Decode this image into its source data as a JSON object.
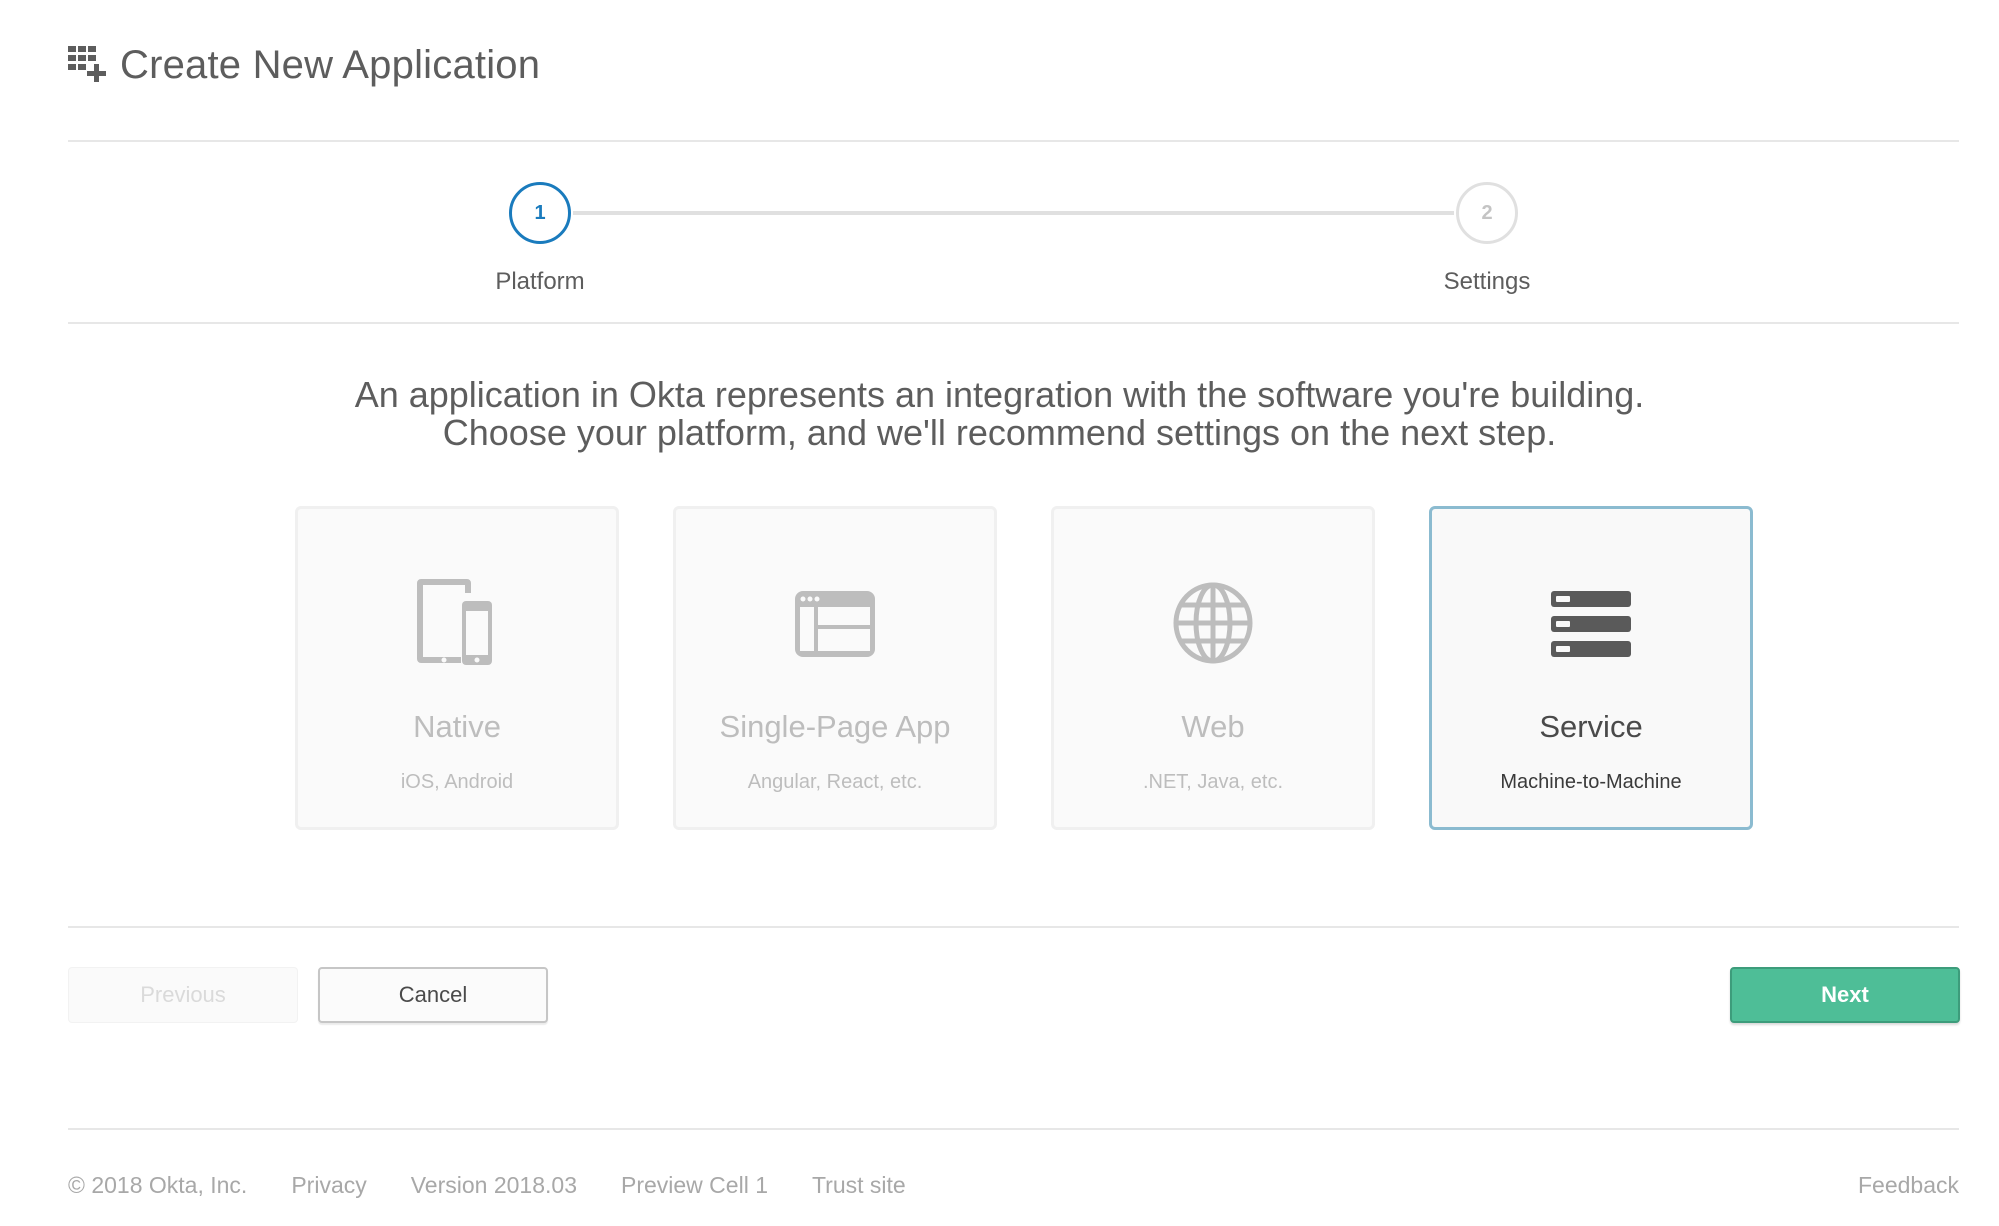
{
  "header": {
    "title": "Create New Application",
    "icon": "grid-add-icon"
  },
  "wizard": {
    "steps": [
      {
        "number": "1",
        "label": "Platform",
        "state": "active"
      },
      {
        "number": "2",
        "label": "Settings",
        "state": "inactive"
      }
    ],
    "accent_color": "#1a7bbd"
  },
  "description": {
    "line1": "An application in Okta represents an integration with the software you're building.",
    "line2": "Choose your platform, and we'll recommend settings on the next step."
  },
  "platforms": [
    {
      "title": "Native",
      "subtitle": "iOS, Android",
      "icon": "mobile-devices-icon",
      "selected": false
    },
    {
      "title": "Single-Page App",
      "subtitle": "Angular, React, etc.",
      "icon": "browser-window-icon",
      "selected": false
    },
    {
      "title": "Web",
      "subtitle": ".NET, Java, etc.",
      "icon": "globe-icon",
      "selected": false
    },
    {
      "title": "Service",
      "subtitle": "Machine-to-Machine",
      "icon": "server-icon",
      "selected": true
    }
  ],
  "buttons": {
    "previous": "Previous",
    "cancel": "Cancel",
    "next": "Next",
    "next_color": "#4ebe97"
  },
  "footer": {
    "copyright": "© 2018 Okta, Inc.",
    "privacy": "Privacy",
    "version": "Version 2018.03",
    "cell": "Preview Cell 1",
    "trust": "Trust site",
    "feedback": "Feedback"
  }
}
